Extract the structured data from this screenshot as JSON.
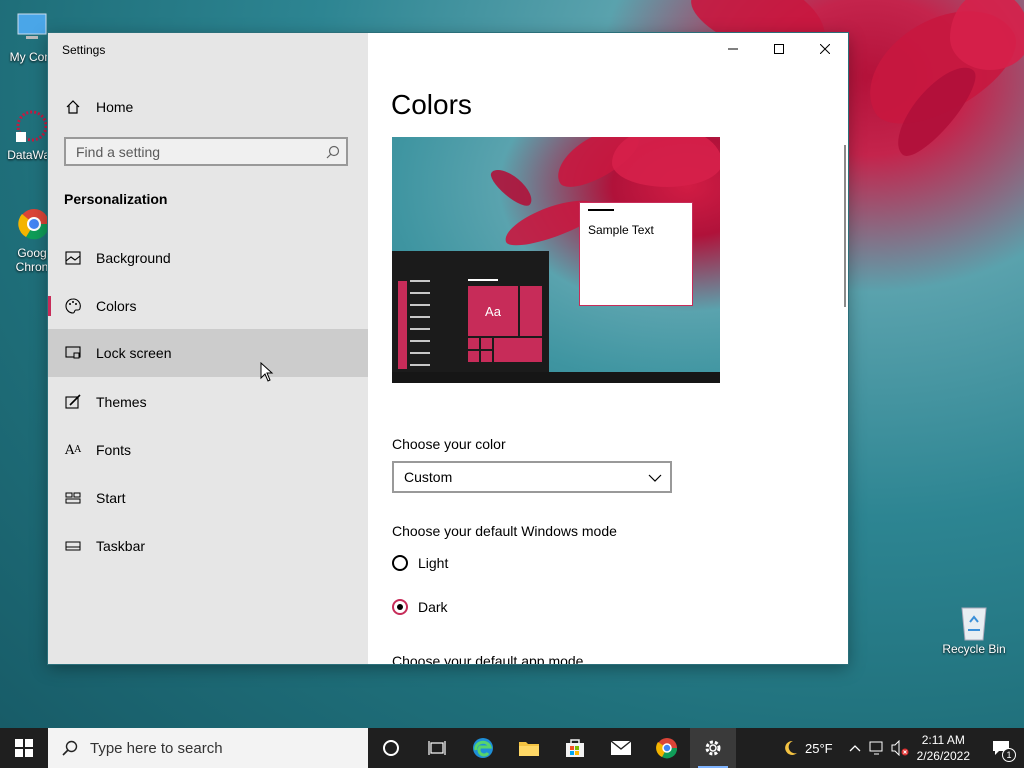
{
  "desktop": {
    "icons": [
      {
        "label": "My Com"
      },
      {
        "label": "DataWag"
      },
      {
        "label": "Goog Chron"
      },
      {
        "label": "Recycle Bin"
      }
    ]
  },
  "window": {
    "title": "Settings",
    "controls": {
      "minimize": "minimize",
      "maximize": "maximize",
      "close": "close"
    }
  },
  "sidebar": {
    "home": "Home",
    "search_placeholder": "Find a setting",
    "section": "Personalization",
    "items": [
      {
        "label": "Background",
        "icon": "picture-icon"
      },
      {
        "label": "Colors",
        "icon": "palette-icon",
        "selected": true
      },
      {
        "label": "Lock screen",
        "icon": "lock-screen-icon",
        "hovered": true
      },
      {
        "label": "Themes",
        "icon": "brush-icon"
      },
      {
        "label": "Fonts",
        "icon": "font-icon"
      },
      {
        "label": "Start",
        "icon": "start-icon"
      },
      {
        "label": "Taskbar",
        "icon": "taskbar-icon"
      }
    ]
  },
  "content": {
    "title": "Colors",
    "preview": {
      "sample_text": "Sample Text",
      "tile_text": "Aa"
    },
    "choose_color_label": "Choose your color",
    "choose_color_value": "Custom",
    "windows_mode_label": "Choose your default Windows mode",
    "windows_mode_options": [
      {
        "label": "Light",
        "checked": false
      },
      {
        "label": "Dark",
        "checked": true
      }
    ],
    "app_mode_label": "Choose your default app mode"
  },
  "taskbar": {
    "search_placeholder": "Type here to search",
    "weather": "25°F",
    "time": "2:11 AM",
    "date": "2/26/2022",
    "notification_count": "1"
  },
  "colors": {
    "accent": "#c72c59",
    "sidebar_bg": "#e6e6e6",
    "taskbar_bg": "#1f1f1f"
  }
}
